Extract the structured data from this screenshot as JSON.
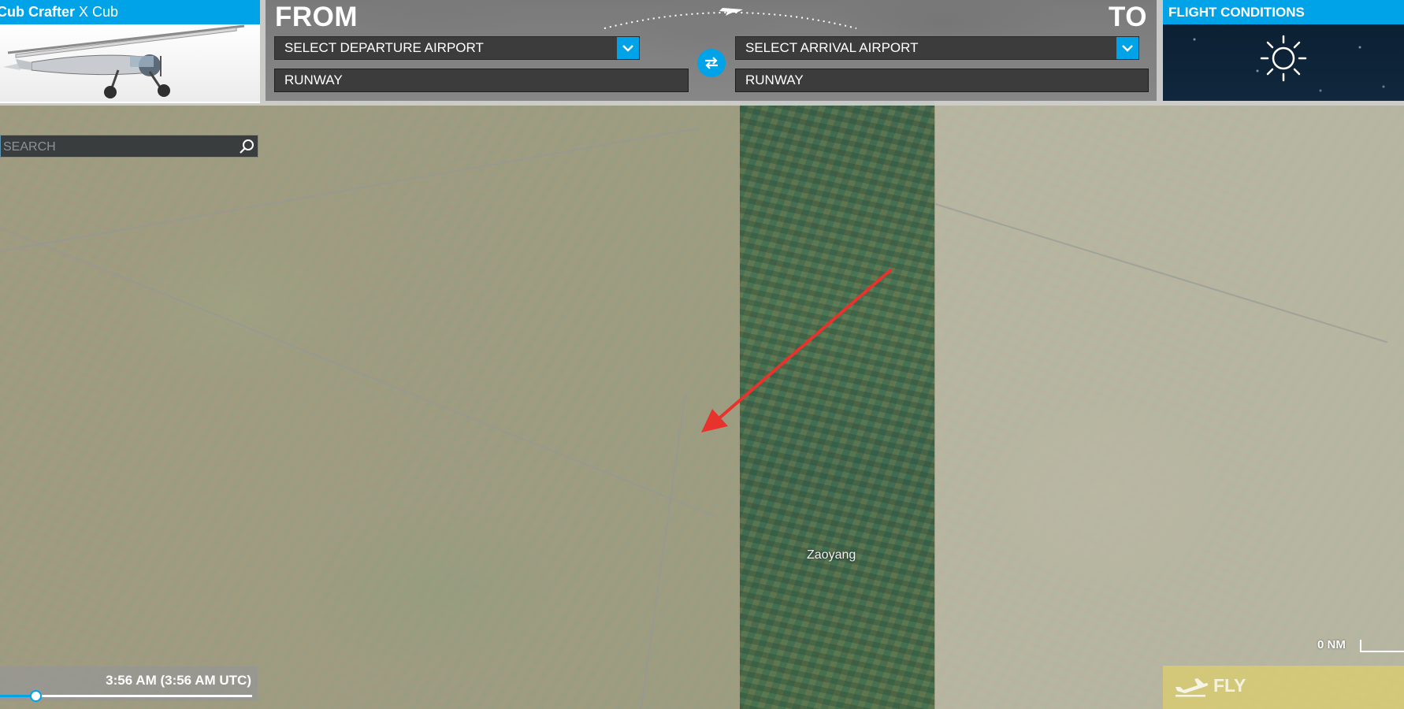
{
  "aircraft": {
    "brand": "Cub Crafter",
    "model": "X Cub"
  },
  "route": {
    "from_label": "FROM",
    "to_label": "TO",
    "departure": {
      "airport_select": "SELECT DEPARTURE AIRPORT",
      "runway": "RUNWAY"
    },
    "arrival": {
      "airport_select": "SELECT ARRIVAL AIRPORT",
      "runway": "RUNWAY"
    }
  },
  "conditions": {
    "title": "FLIGHT CONDITIONS",
    "weather_icon": "sun-icon"
  },
  "search": {
    "placeholder": "SEARCH",
    "value": ""
  },
  "map": {
    "place_label": "Zaoyang",
    "scale_label": "0 NM"
  },
  "time": {
    "display": "3:56 AM (3:56 AM UTC)",
    "slider_fraction": 0.14
  },
  "fly_button": {
    "label": "FLY"
  },
  "colors": {
    "accent": "#00a2e8",
    "annotation": "#e8322c",
    "fly": "#ebd75a"
  }
}
